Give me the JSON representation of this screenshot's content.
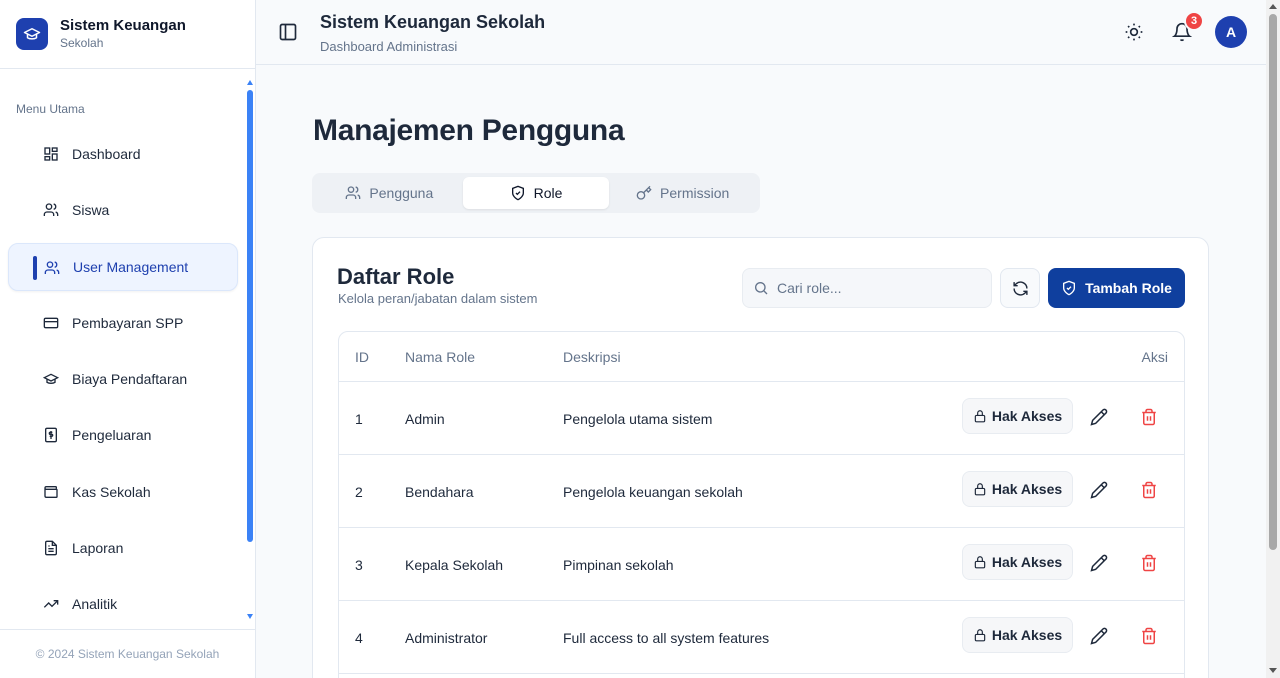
{
  "brand": {
    "title": "Sistem Keuangan",
    "subtitle": "Sekolah"
  },
  "sidebar": {
    "section_label": "Menu Utama",
    "items": [
      {
        "label": "Dashboard",
        "icon": "dashboard-icon"
      },
      {
        "label": "Siswa",
        "icon": "users-icon"
      },
      {
        "label": "User Management",
        "icon": "user-management-icon",
        "active": true
      },
      {
        "label": "Pembayaran SPP",
        "icon": "credit-card-icon"
      },
      {
        "label": "Biaya Pendaftaran",
        "icon": "graduation-cap-icon"
      },
      {
        "label": "Pengeluaran",
        "icon": "receipt-icon"
      },
      {
        "label": "Kas Sekolah",
        "icon": "wallet-icon"
      },
      {
        "label": "Laporan",
        "icon": "file-text-icon"
      },
      {
        "label": "Analitik",
        "icon": "trending-up-icon"
      }
    ],
    "footer": "© 2024 Sistem Keuangan Sekolah"
  },
  "header": {
    "title": "Sistem Keuangan Sekolah",
    "subtitle": "Dashboard Administrasi",
    "notification_count": "3",
    "avatar_initial": "A"
  },
  "page": {
    "title": "Manajemen Pengguna",
    "tabs": [
      {
        "label": "Pengguna",
        "icon": "users-icon"
      },
      {
        "label": "Role",
        "icon": "shield-icon",
        "active": true
      },
      {
        "label": "Permission",
        "icon": "key-icon"
      }
    ]
  },
  "card": {
    "title": "Daftar Role",
    "subtitle": "Kelola peran/jabatan dalam sistem",
    "search_placeholder": "Cari role...",
    "add_label": "Tambah Role",
    "table": {
      "headers": {
        "id": "ID",
        "name": "Nama Role",
        "desc": "Deskripsi",
        "action": "Aksi"
      },
      "access_label": "Hak Akses",
      "rows": [
        {
          "id": "1",
          "name": "Admin",
          "desc": "Pengelola utama sistem"
        },
        {
          "id": "2",
          "name": "Bendahara",
          "desc": "Pengelola keuangan sekolah"
        },
        {
          "id": "3",
          "name": "Kepala Sekolah",
          "desc": "Pimpinan sekolah"
        },
        {
          "id": "4",
          "name": "Administrator",
          "desc": "Full access to all system features"
        }
      ]
    }
  },
  "colors": {
    "primary": "#1e40af",
    "button": "#0f3f9e",
    "danger": "#ef4444"
  }
}
